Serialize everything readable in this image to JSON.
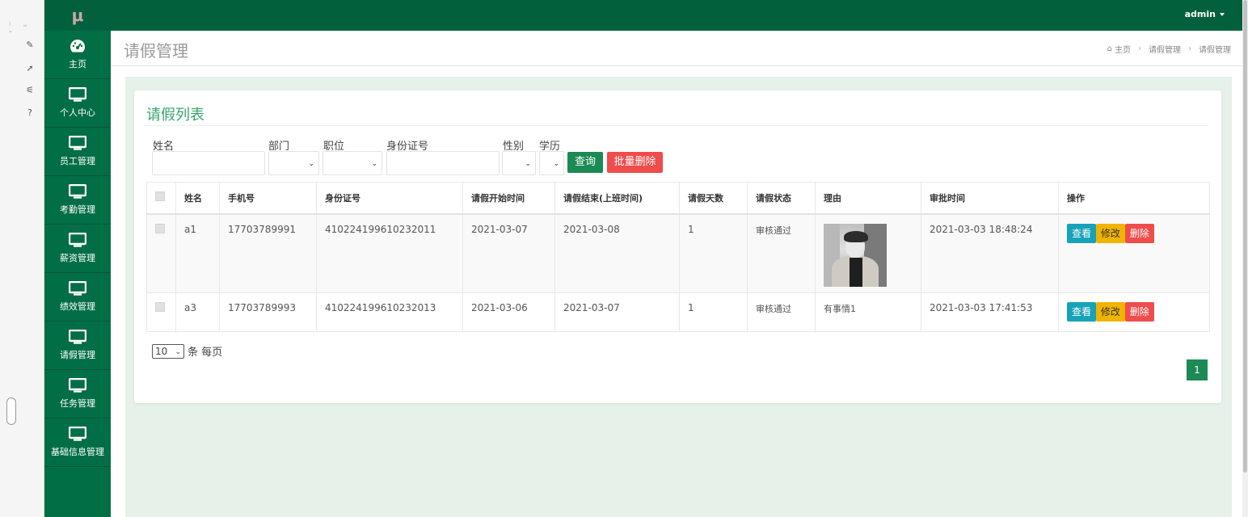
{
  "app": {
    "logo": "μ",
    "user": "admin"
  },
  "sidebar": {
    "items": [
      {
        "label": "主页",
        "icon": "dashboard-icon"
      },
      {
        "label": "个人中心",
        "icon": "monitor-icon"
      },
      {
        "label": "员工管理",
        "icon": "monitor-icon"
      },
      {
        "label": "考勤管理",
        "icon": "monitor-icon"
      },
      {
        "label": "薪资管理",
        "icon": "monitor-icon"
      },
      {
        "label": "绩效管理",
        "icon": "monitor-icon"
      },
      {
        "label": "请假管理",
        "icon": "monitor-icon"
      },
      {
        "label": "任务管理",
        "icon": "monitor-icon"
      },
      {
        "label": "基础信息管理",
        "icon": "monitor-icon"
      }
    ]
  },
  "header": {
    "title": "请假管理",
    "breadcrumb": [
      "主页",
      "请假管理",
      "请假管理"
    ]
  },
  "card": {
    "title": "请假列表"
  },
  "filters": {
    "name_label": "姓名",
    "dept_label": "部门",
    "position_label": "职位",
    "idcard_label": "身份证号",
    "gender_label": "性别",
    "education_label": "学历",
    "query_button": "查询",
    "batch_delete_button": "批量删除"
  },
  "table": {
    "headers": [
      "姓名",
      "手机号",
      "身份证号",
      "请假开始时间",
      "请假结束(上班时间)",
      "请假天数",
      "请假状态",
      "理由",
      "审批时间",
      "操作"
    ],
    "rows": [
      {
        "name": "a1",
        "phone": "17703789991",
        "idcard": "410224199610232011",
        "start": "2021-03-07",
        "end": "2021-03-08",
        "days": "1",
        "status": "审核通过",
        "reason": "",
        "approved": "2021-03-03 18:48:24"
      },
      {
        "name": "a3",
        "phone": "17703789993",
        "idcard": "410224199610232013",
        "start": "2021-03-06",
        "end": "2021-03-07",
        "days": "1",
        "status": "审核通过",
        "reason": "有事情1",
        "approved": "2021-03-03 17:41:53"
      }
    ],
    "actions": {
      "view": "查看",
      "edit": "修改",
      "delete": "删除"
    }
  },
  "pagination": {
    "page_size": "10",
    "page_size_suffix": "条 每页",
    "current_page": "1"
  },
  "colors": {
    "sidebar": "#026e46",
    "topbar": "#02603d",
    "accent": "#38a36b",
    "danger": "#ef4c4c",
    "warning": "#f0b400",
    "info": "#17a2b8"
  }
}
